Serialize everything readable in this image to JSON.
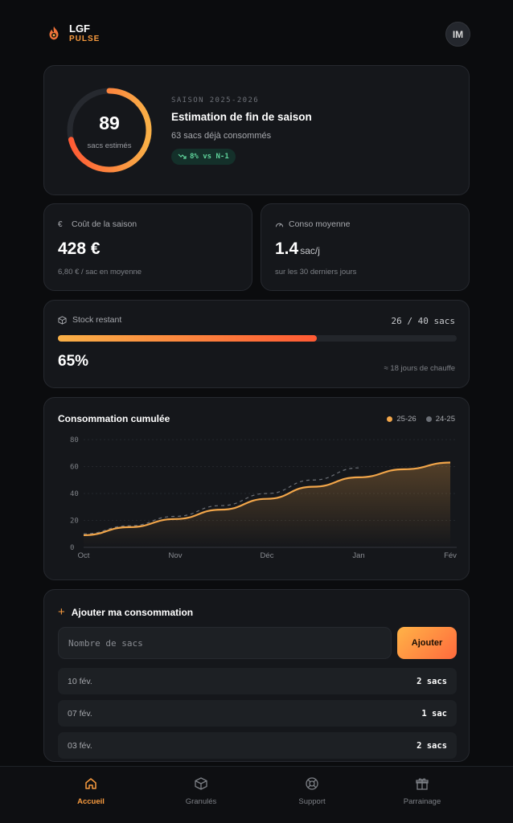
{
  "app": {
    "brand_top": "LGF",
    "brand_bottom": "PULSE",
    "avatar_initials": "IM"
  },
  "hero": {
    "sacks_estimated": "89",
    "sacks_estimated_label": "sacs estimés",
    "season_label": "SAISON 2025-2026",
    "title": "Estimation de fin de saison",
    "subtitle": "63 sacs déjà consommés",
    "trend": "8% vs N-1",
    "ring_progress": 0.71,
    "accent_start": "#f9b047",
    "accent_end": "#ff5a34"
  },
  "cost": {
    "label": "Coût de la saison",
    "icon": "euro-icon",
    "value": "428 €",
    "foot": "6,80 € / sac en moyenne"
  },
  "average": {
    "label": "Conso moyenne",
    "icon": "gauge-icon",
    "value": "1.4",
    "unit": "sac/j",
    "foot": "sur les 30 derniers jours"
  },
  "stock": {
    "label": "Stock restant",
    "icon": "box-icon",
    "count": "26 / 40 sacs",
    "percent": "65%",
    "fill_fraction": 0.65,
    "days": "≈ 18 jours de chauffe"
  },
  "chart_data": {
    "type": "line",
    "title": "Consommation cumulée",
    "x": [
      "Oct",
      "Nov",
      "Déc",
      "Jan",
      "Fév"
    ],
    "ylim": [
      0,
      80
    ],
    "yticks": [
      0,
      20,
      40,
      60,
      80
    ],
    "grid": true,
    "legend_position": "top-right",
    "series": [
      {
        "name": "25-26",
        "color": "#f2a64a",
        "x": [
          0,
          0.5,
          1,
          1.5,
          2,
          2.5,
          3,
          3.5,
          4
        ],
        "values": [
          9,
          15,
          21,
          28,
          36,
          45,
          52,
          58,
          63
        ]
      },
      {
        "name": "24-25",
        "color": "#6b6f76",
        "x": [
          0,
          0.5,
          1,
          1.5,
          2,
          2.5,
          3
        ],
        "values": [
          10,
          16,
          23,
          31,
          40,
          50,
          59
        ]
      }
    ]
  },
  "add": {
    "title": "Ajouter ma consommation",
    "placeholder": "Nombre de sacs",
    "button": "Ajouter",
    "entries": [
      {
        "date": "10 fév.",
        "qty": "2 sacs"
      },
      {
        "date": "07 fév.",
        "qty": "1 sac"
      },
      {
        "date": "03 fév.",
        "qty": "2 sacs"
      }
    ]
  },
  "nav": {
    "items": [
      {
        "label": "Accueil",
        "icon": "home-icon",
        "active": true
      },
      {
        "label": "Granulés",
        "icon": "box-icon"
      },
      {
        "label": "Support",
        "icon": "lifebuoy-icon"
      },
      {
        "label": "Parrainage",
        "icon": "gift-icon"
      }
    ]
  }
}
